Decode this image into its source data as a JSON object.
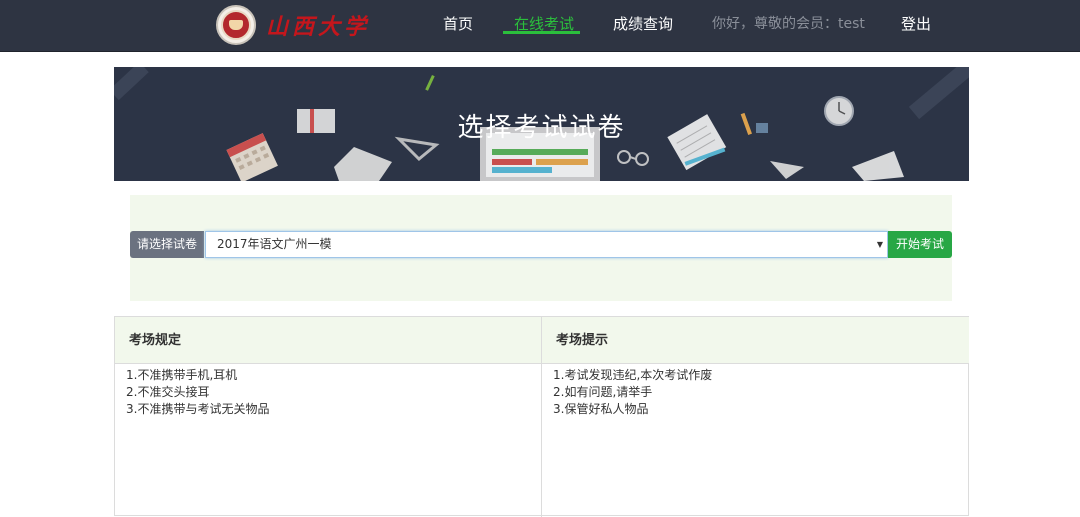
{
  "header": {
    "logo_text": "山西大学",
    "nav": [
      "首页",
      "在线考试",
      "成绩查询"
    ],
    "active_nav": "在线考试",
    "greeting": "你好，尊敬的会员：test",
    "logout": "登出"
  },
  "banner": {
    "title": "选择考试试卷"
  },
  "exam_select": {
    "label": "请选择试卷",
    "selected": "2017年语文广州一模",
    "start_button": "开始考试"
  },
  "rules": {
    "left_title": "考场规定",
    "left_items": [
      "1.不准携带手机,耳机",
      "2.不准交头接耳",
      "3.不准携带与考试无关物品"
    ],
    "right_title": "考场提示",
    "right_items": [
      "1.考试发现违纪,本次考试作废",
      "2.如有问题,请举手",
      "3.保管好私人物品"
    ]
  },
  "colors": {
    "navbar": "#2e3442",
    "accent_green": "#2bbf3c",
    "button_green": "#28a745",
    "panel_bg": "#f2f8ec",
    "logo_red": "#c4161c"
  }
}
